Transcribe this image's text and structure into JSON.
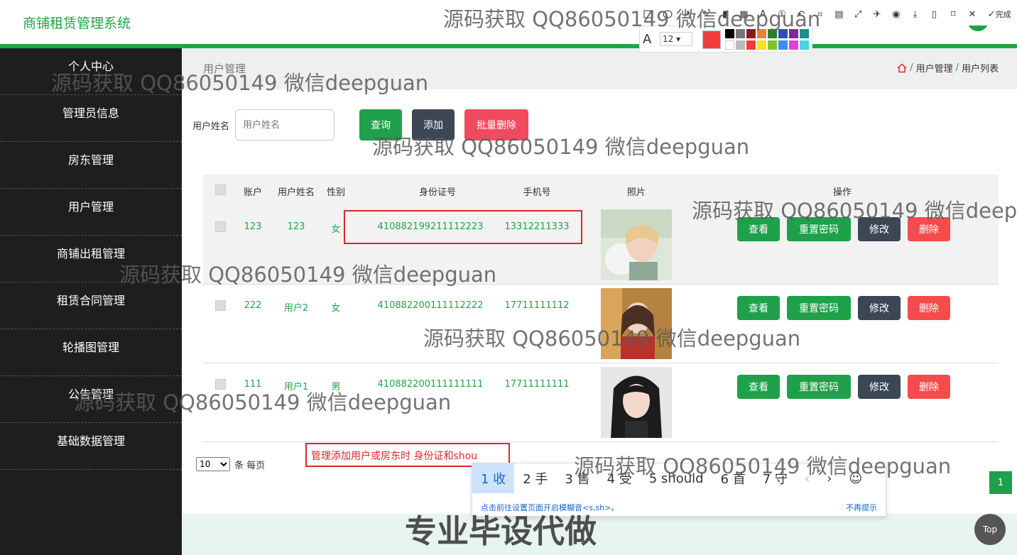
{
  "app": {
    "title": "商铺租赁管理系统"
  },
  "sidebar": {
    "items": [
      {
        "label": "个人中心"
      },
      {
        "label": "管理员信息"
      },
      {
        "label": "房东管理"
      },
      {
        "label": "用户管理"
      },
      {
        "label": "商铺出租管理"
      },
      {
        "label": "租赁合同管理"
      },
      {
        "label": "轮播图管理"
      },
      {
        "label": "公告管理"
      },
      {
        "label": "基础数据管理"
      }
    ]
  },
  "breadcrumb": {
    "title": "用户管理",
    "path": [
      "用户管理",
      "用户列表"
    ],
    "separator": "/"
  },
  "search": {
    "label": "用户姓名",
    "placeholder": "用户姓名",
    "query_label": "查询",
    "add_label": "添加",
    "bulk_delete_label": "批量删除"
  },
  "table": {
    "headers": {
      "account": "账户",
      "name": "用户姓名",
      "gender": "性别",
      "id_card": "身份证号",
      "phone": "手机号",
      "photo": "照片",
      "actions": "操作"
    },
    "actions": {
      "view": "查看",
      "reset": "重置密码",
      "edit": "修改",
      "delete": "删除"
    },
    "rows": [
      {
        "account": "123",
        "name": "123",
        "gender": "女",
        "id_card": "410882199211112223",
        "phone": "13312211333"
      },
      {
        "account": "222",
        "name": "用户2",
        "gender": "女",
        "id_card": "410882200111112222",
        "phone": "17711111112"
      },
      {
        "account": "111",
        "name": "用户1",
        "gender": "男",
        "id_card": "410882200111111111",
        "phone": "17711111111"
      }
    ]
  },
  "pager": {
    "page_size": "10",
    "suffix": "条 每页",
    "current_page": "1"
  },
  "annotation": {
    "text": "管理添加用户或房东时 身份证和shou"
  },
  "ime": {
    "candidates": [
      "1 收",
      "2 手",
      "3 售",
      "4 受",
      "5 should",
      "6 首",
      "7 守"
    ],
    "hint": "点击前往设置页面开启模糊音<s,sh>。",
    "dismiss": "不再提示",
    "prev": "‹",
    "next": "›",
    "emoji": "☺"
  },
  "snip_toolbar": {
    "font_size": "12",
    "done_label": "完成",
    "font_icon_label": "A",
    "accent": "#f03c3c"
  },
  "top_button": {
    "label": "Top"
  },
  "watermarks": {
    "text": "源码获取 QQ86050149 微信deepguan",
    "text_partial": "源码获取 QQ86050149 微信deep",
    "banner": "专业毕设代做"
  },
  "colors": {
    "brand": "#22a447",
    "sidebar_bg": "#1d1f1e",
    "danger": "#f44c4c",
    "dark_btn": "#3c4755"
  }
}
